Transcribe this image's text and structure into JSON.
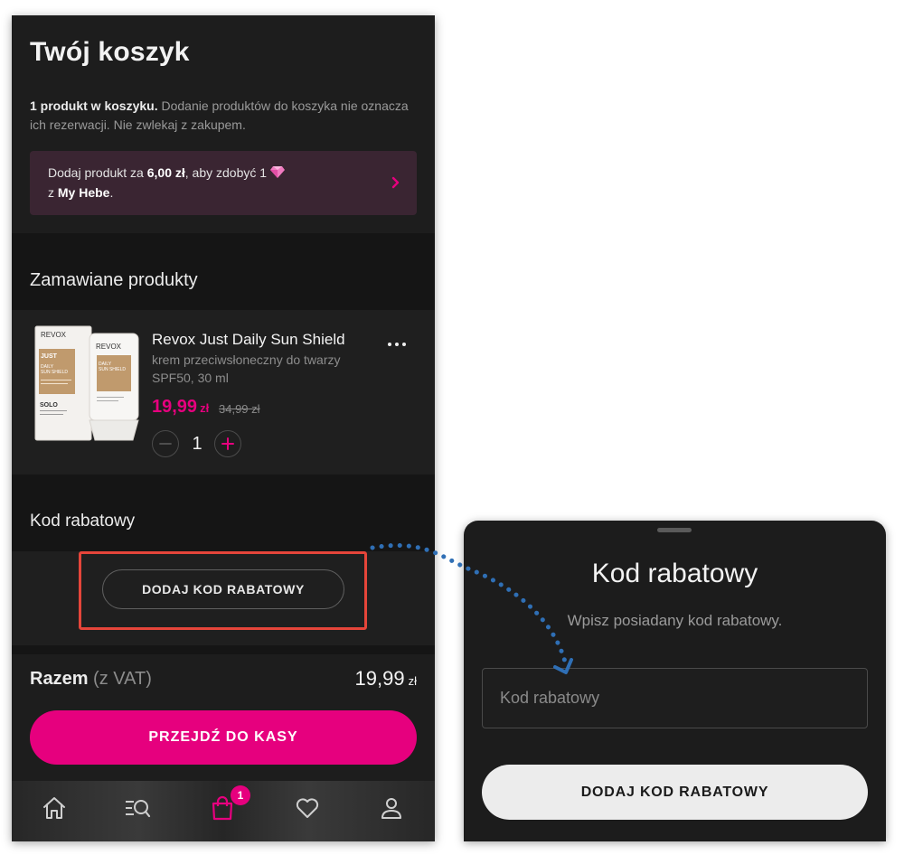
{
  "cart": {
    "title": "Twój koszyk",
    "info_bold": "1 produkt w koszyku.",
    "info_text": " Dodanie produktów do koszyka nie oznacza ich rezerwacji. Nie zwlekaj z zakupem.",
    "promo": {
      "text_before": "Dodaj produkt za ",
      "amount": "6,00 zł",
      "text_after": ", aby zdobyć 1 ",
      "line2_prefix": "z ",
      "brand": "My Hebe",
      "period": ".",
      "icon": "gem-icon",
      "arrow_icon": "chevron-right-icon"
    },
    "products_heading": "Zamawiane produkty",
    "product": {
      "name": "Revox Just Daily Sun Shield",
      "description": "krem przeciwsłoneczny do twarzy SPF50, 30 ml",
      "price": "19,99",
      "currency": "zł",
      "old_price": "34,99 zł",
      "quantity": "1",
      "image_labels": {
        "brand": "REVOX",
        "line": "JUST",
        "name_line1": "DAILY",
        "name_line2": "SUN SHIELD",
        "solo": "SOLO"
      }
    },
    "discount_heading": "Kod rabatowy",
    "discount_button": "DODAJ KOD RABATOWY",
    "total_label": "Razem",
    "total_vat": "(z VAT)",
    "total_value": "19,99",
    "total_currency": "zł",
    "checkout_button": "PRZEJDŹ DO KASY",
    "tabbar": {
      "items": [
        "home-icon",
        "search-list-icon",
        "bag-icon",
        "heart-icon",
        "user-icon"
      ],
      "cart_badge": "1",
      "accent": "#e6007e"
    }
  },
  "sheet": {
    "title": "Kod rabatowy",
    "subtitle": "Wpisz posiadany kod rabatowy.",
    "input_placeholder": "Kod rabatowy",
    "input_value": "",
    "button": "DODAJ KOD RABATOWY"
  },
  "colors": {
    "accent": "#e6007e",
    "background": "#1a1a1a",
    "highlight": "#e5453a",
    "connector": "#2f6fb5"
  }
}
